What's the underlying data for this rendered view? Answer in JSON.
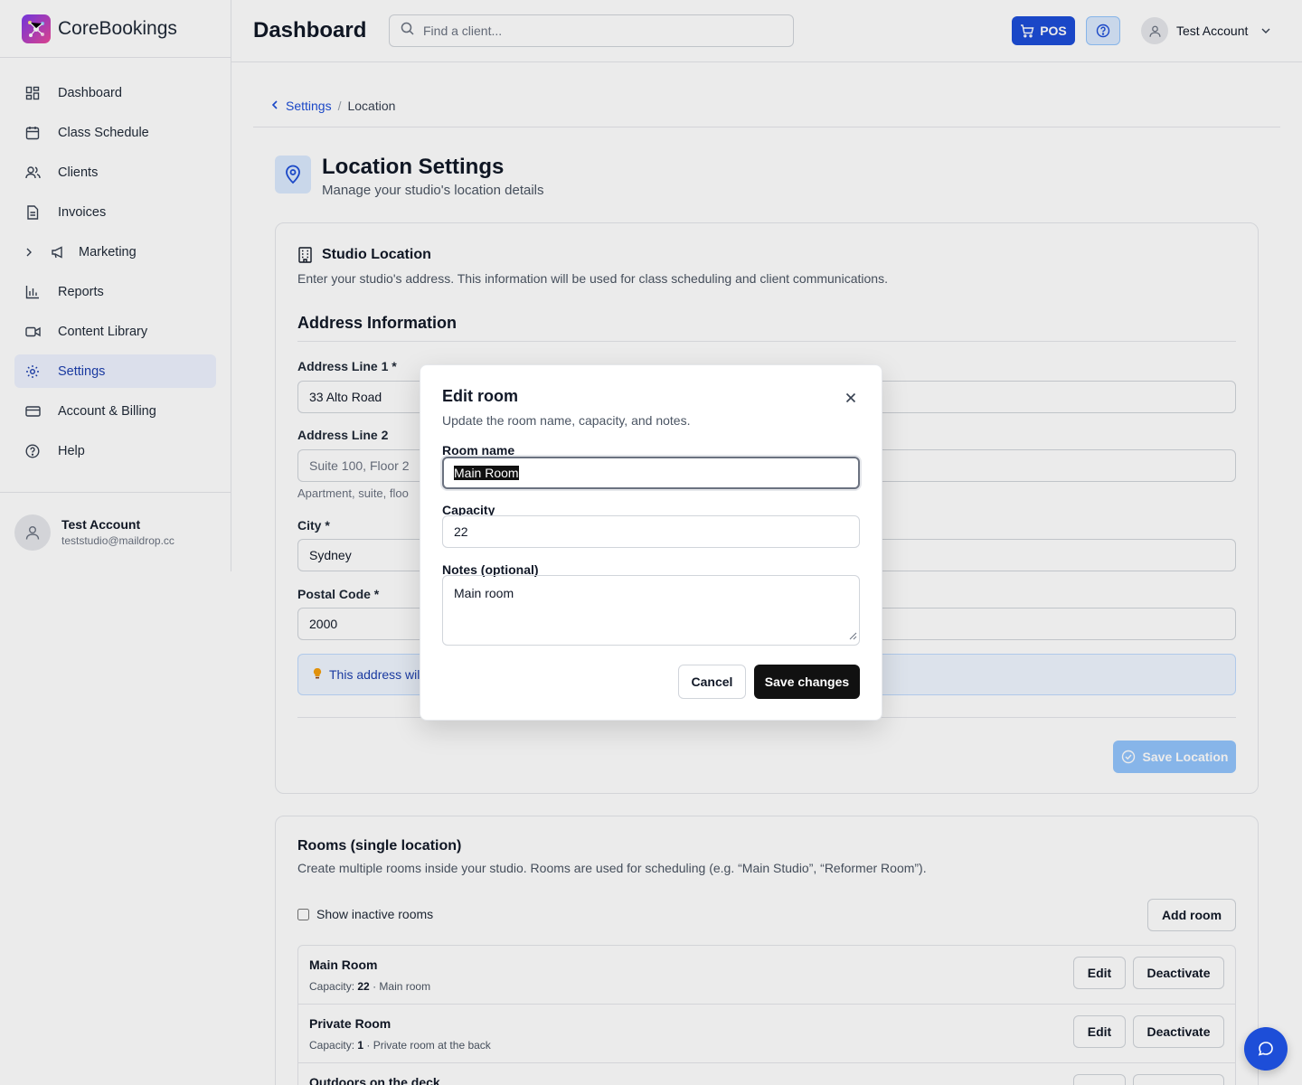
{
  "brand": {
    "name": "CoreBookings",
    "logo_icon": "network-logo-icon"
  },
  "sidebar": {
    "items": [
      {
        "label": "Dashboard",
        "icon": "grid-icon"
      },
      {
        "label": "Class Schedule",
        "icon": "calendar-icon"
      },
      {
        "label": "Clients",
        "icon": "users-icon"
      },
      {
        "label": "Invoices",
        "icon": "document-icon"
      },
      {
        "label": "Marketing",
        "icon": "megaphone-icon",
        "expandable": true
      },
      {
        "label": "Reports",
        "icon": "bar-chart-icon"
      },
      {
        "label": "Content Library",
        "icon": "video-icon"
      },
      {
        "label": "Settings",
        "icon": "gear-icon",
        "active": true
      },
      {
        "label": "Account & Billing",
        "icon": "credit-card-icon"
      },
      {
        "label": "Help",
        "icon": "help-circle-icon"
      }
    ],
    "user": {
      "name": "Test Account",
      "email": "teststudio@maildrop.cc"
    }
  },
  "header": {
    "title": "Dashboard",
    "search_placeholder": "Find a client...",
    "pos_label": "POS",
    "account_name": "Test Account"
  },
  "breadcrumb": {
    "parent": "Settings",
    "separator": "/",
    "current": "Location"
  },
  "location": {
    "title": "Location Settings",
    "subtitle": "Manage your studio's location details",
    "card_title": "Studio Location",
    "card_desc": "Enter your studio's address. This information will be used for class scheduling and client communications.",
    "section_title": "Address Information",
    "fields": {
      "address1_label": "Address Line 1 *",
      "address1_value": "33 Alto Road",
      "address2_label": "Address Line 2",
      "address2_placeholder": "Suite 100, Floor 2",
      "address2_help": "Apartment, suite, floo",
      "city_label": "City *",
      "city_value": "Sydney",
      "postal_label": "Postal Code *",
      "postal_value": "2000"
    },
    "info_banner": "This address will",
    "save_label": "Save Location"
  },
  "rooms": {
    "title": "Rooms (single location)",
    "desc": "Create multiple rooms inside your studio. Rooms are used for scheduling (e.g. “Main Studio”, “Reformer Room”).",
    "show_inactive_label": "Show inactive rooms",
    "add_label": "Add room",
    "edit_label": "Edit",
    "deactivate_label": "Deactivate",
    "capacity_prefix": "Capacity:",
    "list": [
      {
        "name": "Main Room",
        "capacity": "22",
        "note": "· Main room"
      },
      {
        "name": "Private Room",
        "capacity": "1",
        "note": "· Private room at the back"
      },
      {
        "name": "Outdoors on the deck",
        "capacity": "",
        "note": ""
      }
    ]
  },
  "modal": {
    "title": "Edit room",
    "subtitle": "Update the room name, capacity, and notes.",
    "room_name_label": "Room name",
    "room_name_value": "Main Room",
    "capacity_label": "Capacity",
    "capacity_value": "22",
    "notes_label": "Notes (optional)",
    "notes_value": "Main room",
    "cancel_label": "Cancel",
    "save_label": "Save changes"
  },
  "colors": {
    "primary": "#1d4ed8",
    "active_bg": "#eef2ff",
    "dark_button": "#111111"
  }
}
